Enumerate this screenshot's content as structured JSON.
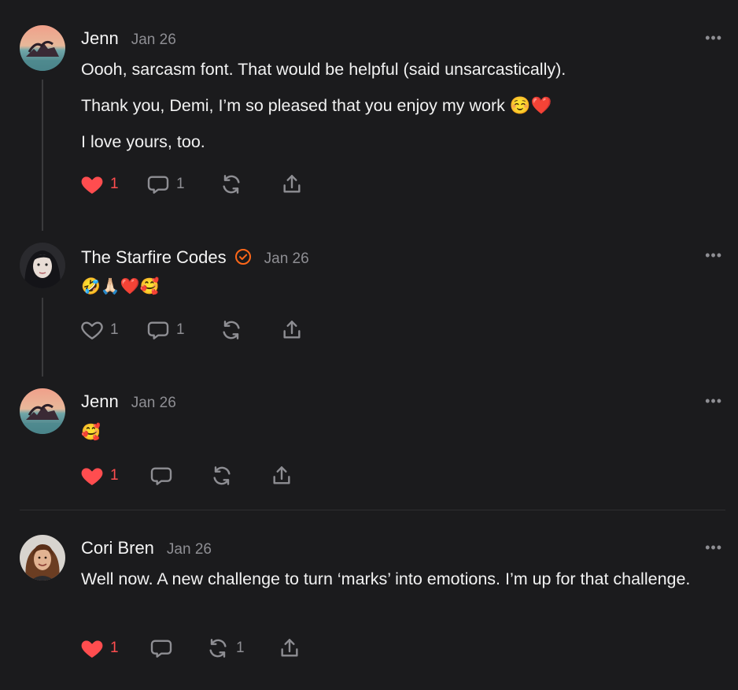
{
  "comments": [
    {
      "author": "Jenn",
      "date": "Jan 26",
      "paragraphs": [
        "Oooh, sarcasm font. That would be helpful (said unsarcastically).",
        "Thank you, Demi, I’m so pleased that you enjoy my work ☺️❤️",
        "I love yours, too."
      ],
      "likes": "1",
      "replies": "1",
      "restacks": "",
      "liked": true
    },
    {
      "author": "The Starfire Codes",
      "date": "Jan 26",
      "verified": true,
      "paragraphs": [
        "🤣🙏🏻❤️🥰"
      ],
      "likes": "1",
      "replies": "1",
      "restacks": "",
      "liked": false
    },
    {
      "author": "Jenn",
      "date": "Jan 26",
      "paragraphs": [
        "🥰"
      ],
      "likes": "1",
      "replies": "",
      "restacks": "",
      "liked": true
    },
    {
      "author": "Cori Bren",
      "date": "Jan 26",
      "paragraphs": [
        "Well now. A new challenge to turn ‘marks’ into emotions. I’m up for that challenge."
      ],
      "likes": "1",
      "replies": "",
      "restacks": "1",
      "liked": true
    }
  ],
  "more_label": "•••",
  "colors": {
    "background": "#1b1b1d",
    "like_active": "#ff4d4f",
    "verified_badge": "#ff6719",
    "muted": "#8e8e93"
  },
  "icons": {
    "like": "heart-icon",
    "reply": "speech-bubble-icon",
    "restack": "restack-icon",
    "share": "share-icon",
    "verified": "verified-check-icon",
    "more": "more-dots-icon"
  }
}
